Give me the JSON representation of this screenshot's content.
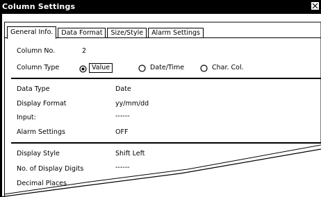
{
  "window": {
    "title": "Column Settings"
  },
  "tabs": [
    {
      "label": "General Info."
    },
    {
      "label": "Data Format"
    },
    {
      "label": "Size/Style"
    },
    {
      "label": "Alarm Settings"
    }
  ],
  "column_no": {
    "label": "Column No.",
    "value": "2"
  },
  "column_type": {
    "label": "Column Type",
    "options": [
      {
        "label": "Value",
        "selected": true
      },
      {
        "label": "Date/Time",
        "selected": false
      },
      {
        "label": "Char. Col.",
        "selected": false
      }
    ]
  },
  "fields_1": [
    {
      "label": "Data Type",
      "value": "Date"
    },
    {
      "label": "Display Format",
      "value": "yy/mm/dd"
    },
    {
      "label": "Input:",
      "value": "------"
    },
    {
      "label": "Alarm Settings",
      "value": "OFF"
    }
  ],
  "fields_2": [
    {
      "label": "Display Style",
      "value": "Shift Left"
    },
    {
      "label": "No. of Display Digits",
      "value": "------"
    },
    {
      "label": "Decimal Places",
      "value": ""
    }
  ]
}
